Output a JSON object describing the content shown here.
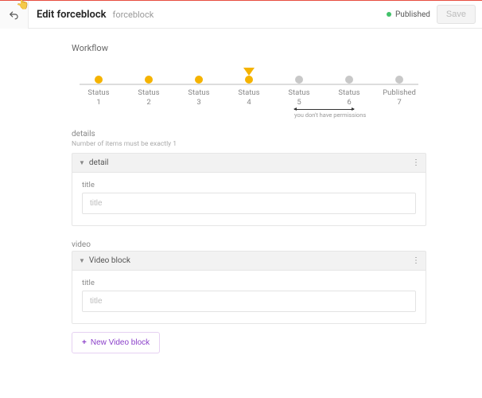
{
  "header": {
    "title": "Edit forceblock",
    "subtitle": "forceblock",
    "status_label": "Published",
    "save_label": "Save"
  },
  "workflow": {
    "section_title": "Workflow",
    "permissions_note": "you don't have permissions",
    "steps": [
      {
        "label": "Status\n1",
        "state": "active",
        "marker": false
      },
      {
        "label": "Status\n2",
        "state": "active",
        "marker": false
      },
      {
        "label": "Status\n3",
        "state": "active",
        "marker": false
      },
      {
        "label": "Status\n4",
        "state": "active",
        "marker": true
      },
      {
        "label": "Status\n5",
        "state": "inactive",
        "marker": false
      },
      {
        "label": "Status\n6",
        "state": "inactive",
        "marker": false
      },
      {
        "label": "Published\n7",
        "state": "inactive",
        "marker": false
      }
    ]
  },
  "sections": {
    "details": {
      "label": "details",
      "hint": "Number of items must be exactly 1",
      "panel_title": "detail",
      "field_label": "title",
      "placeholder": "title"
    },
    "video": {
      "label": "video",
      "panel_title": "Video block",
      "field_label": "title",
      "placeholder": "title",
      "add_label": "New Video block"
    }
  }
}
